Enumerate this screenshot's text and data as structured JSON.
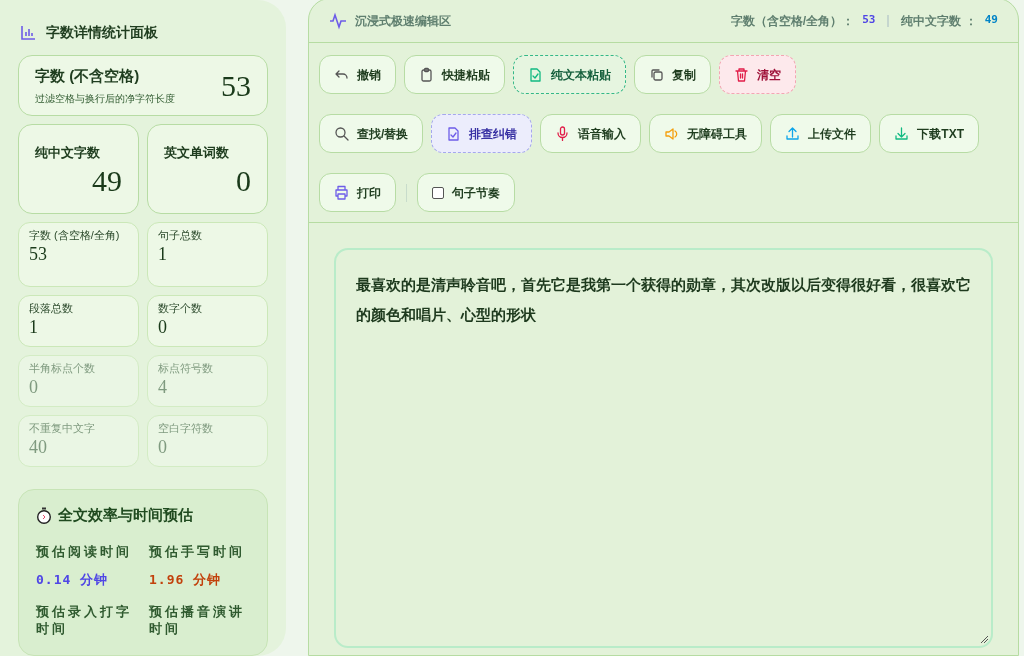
{
  "sidebar": {
    "title": "字数详情统计面板",
    "main_stat": {
      "label": "字数 (不含空格)",
      "caption": "过滤空格与换行后的净字符长度",
      "value": "53"
    },
    "big_stats": [
      {
        "label": "纯中文字数",
        "value": "49"
      },
      {
        "label": "英文单词数",
        "value": "0"
      }
    ],
    "small_stats": [
      {
        "label": "字数 (含空格/全角)",
        "value": "53",
        "muted": false
      },
      {
        "label": "句子总数",
        "value": "1",
        "muted": false
      },
      {
        "label": "段落总数",
        "value": "1",
        "muted": false
      },
      {
        "label": "数字个数",
        "value": "0",
        "muted": false
      },
      {
        "label": "半角标点个数",
        "value": "0",
        "muted": true
      },
      {
        "label": "标点符号数",
        "value": "4",
        "muted": true
      },
      {
        "label": "不重复中文字",
        "value": "40",
        "muted": true
      },
      {
        "label": "空白字符数",
        "value": "0",
        "muted": true
      }
    ],
    "efficiency": {
      "title": "全文效率与时间预估",
      "items": [
        {
          "label": "预估阅读时间",
          "value": "0.14",
          "unit": "分钟",
          "color": "#4f46e5"
        },
        {
          "label": "预估手写时间",
          "value": "1.96",
          "unit": "分钟",
          "color": "#c2410c"
        },
        {
          "label": "预估录入打字时间"
        },
        {
          "label": "预估播音演讲时间"
        }
      ]
    }
  },
  "editor": {
    "title": "沉浸式极速编辑区",
    "header_stats": [
      {
        "label": "字数（含空格/全角）：",
        "value": "53"
      },
      {
        "label": "纯中文字数 ：",
        "value": "49"
      }
    ],
    "toolbar": [
      {
        "label": "撤销",
        "kind": "plain"
      },
      {
        "label": "快捷粘贴",
        "kind": "plain"
      },
      {
        "label": "纯文本粘贴",
        "kind": "dashed-green"
      },
      {
        "label": "复制",
        "kind": "plain"
      },
      {
        "label": "清空",
        "kind": "danger"
      },
      {
        "label": "查找/替换",
        "kind": "plain"
      },
      {
        "label": "排查纠错",
        "kind": "dashed-indigo"
      },
      {
        "label": "语音输入",
        "kind": "plain"
      },
      {
        "label": "无障碍工具",
        "kind": "plain"
      },
      {
        "label": "上传文件",
        "kind": "plain"
      },
      {
        "label": "下载TXT",
        "kind": "plain"
      },
      {
        "label": "打印",
        "kind": "plain"
      },
      {
        "label": "句子节奏",
        "kind": "checkbox",
        "checked": false
      }
    ],
    "text": "最喜欢的是清声聆音吧，首先它是我第一个获得的勋章，其次改版以后变得很好看，很喜欢它的颜色和唱片、心型的形状"
  }
}
